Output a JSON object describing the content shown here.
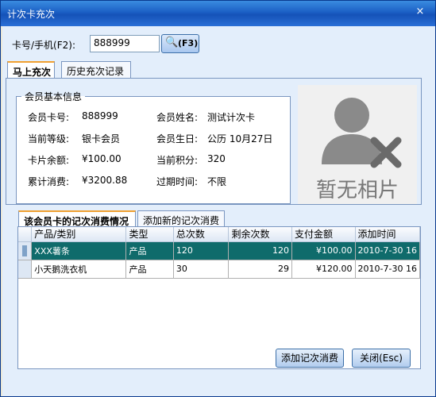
{
  "window": {
    "title": "计次卡充次",
    "close_icon": "×"
  },
  "search": {
    "label": "卡号/手机(F2):",
    "value": "888999",
    "button_label": "(F3)"
  },
  "tabs": [
    "马上充次",
    "历史充次记录"
  ],
  "member_info": {
    "legend": "会员基本信息",
    "fields": [
      {
        "label": "会员卡号:",
        "value": "888999"
      },
      {
        "label": "会员姓名:",
        "value": "测试计次卡"
      },
      {
        "label": "当前等级:",
        "value": "银卡会员"
      },
      {
        "label": "会员生日:",
        "value": "公历 10月27日"
      },
      {
        "label": "卡片余额:",
        "value": "¥100.00"
      },
      {
        "label": "当前积分:",
        "value": "320"
      },
      {
        "label": "累计消费:",
        "value": "¥3200.88"
      },
      {
        "label": "过期时间:",
        "value": "不限"
      }
    ]
  },
  "photo": {
    "placeholder": "暂无相片"
  },
  "sub_tabs": [
    "该会员卡的记次消费情况",
    "添加新的记次消费"
  ],
  "grid": {
    "columns": [
      "产品/类别",
      "类型",
      "总次数",
      "剩余次数",
      "支付金额",
      "添加时间"
    ],
    "rows": [
      {
        "name": "XXX薯条",
        "type": "产品",
        "total": "120",
        "remaining": "120",
        "amount": "¥100.00",
        "time": "2010-7-30 16"
      },
      {
        "name": "小天鹅洗衣机",
        "type": "产品",
        "total": "30",
        "remaining": "29",
        "amount": "¥120.00",
        "time": "2010-7-30 16"
      }
    ]
  },
  "buttons": {
    "add": "添加记次消费",
    "close": "关闭(Esc)"
  },
  "colors": {
    "selected_row": "#0f6b6b",
    "titlebar": "#1b5fc4"
  }
}
